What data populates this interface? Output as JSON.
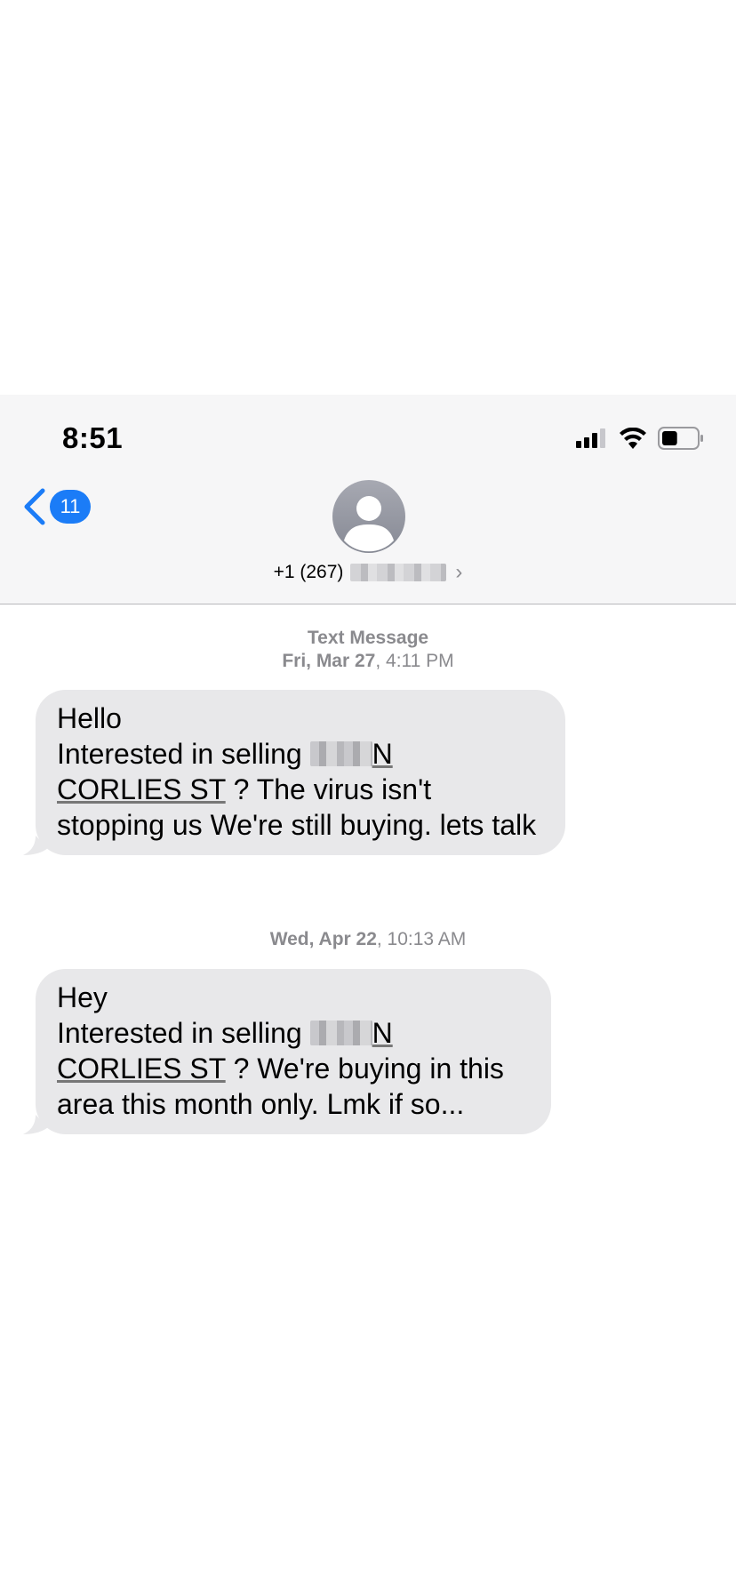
{
  "status_bar": {
    "time": "8:51",
    "icons": [
      "cellular-signal-icon",
      "wifi-icon",
      "battery-icon"
    ],
    "battery_level": 0.45
  },
  "nav": {
    "back_icon": "chevron-left-icon",
    "back_badge": "11",
    "contact_phone": "+1 (267)",
    "contact_chevron": "›",
    "accent_color": "#1b7cf7"
  },
  "conversation": {
    "service_label": "Text Message",
    "messages": [
      {
        "date_bold": "Fri, Mar 27",
        "time": ", 4:11 PM",
        "line1": "Hello",
        "prefix": "Interested in selling ",
        "addr_start": "N",
        "addr_rest": "CORLIES ST",
        "rest": " ? The virus isn't stopping us  We're still buying.  lets talk"
      },
      {
        "date_bold": "Wed, Apr 22",
        "time": ", 10:13 AM",
        "line1": "Hey",
        "prefix": "Interested in selling ",
        "addr_start": "N",
        "addr_rest": "CORLIES ST",
        "rest": " ? We're buying in this area this month only.  Lmk if so..."
      }
    ],
    "bubble_color": "#e8e8ea"
  }
}
